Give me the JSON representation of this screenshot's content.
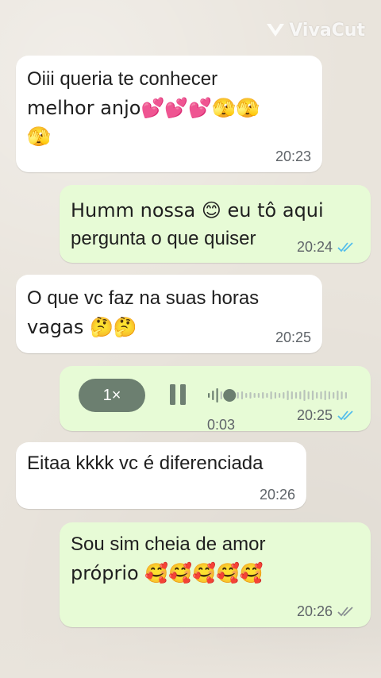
{
  "watermark": {
    "brand": "VivaCut",
    "icon": "vivacut-logo-icon"
  },
  "colors": {
    "incoming": "#ffffff",
    "outgoing": "#e7fbd6",
    "read_ticks": "#53bdeb",
    "sent_ticks": "#8a8f93",
    "meta": "#5f6469"
  },
  "messages": [
    {
      "dir": "in",
      "text_line1": "Oiii queria te conhecer",
      "text_line2": "melhor anjo💕💕💕🫣🫣",
      "text_line3": "🫣",
      "time": "20:23"
    },
    {
      "dir": "out",
      "text_line1": "Humm nossa 😊 eu tô aqui",
      "text_line2": "pergunta o que quiser",
      "time": "20:24",
      "status": "read"
    },
    {
      "dir": "in",
      "text_line1": "O que vc faz na suas horas",
      "text_line2": "vagas 🤔🤔",
      "time": "20:25"
    },
    {
      "dir": "out",
      "type": "voice",
      "speed": "1×",
      "duration": "0:03",
      "time": "20:25",
      "status": "read",
      "progress": 0.08
    },
    {
      "dir": "in",
      "text_line1": "Eitaa kkkk vc é diferenciada",
      "time": "20:26"
    },
    {
      "dir": "out",
      "text_line1": "Sou sim cheia de amor",
      "text_line2": "próprio 🥰🥰🥰🥰🥰",
      "time": "20:26",
      "status": "delivered"
    }
  ]
}
